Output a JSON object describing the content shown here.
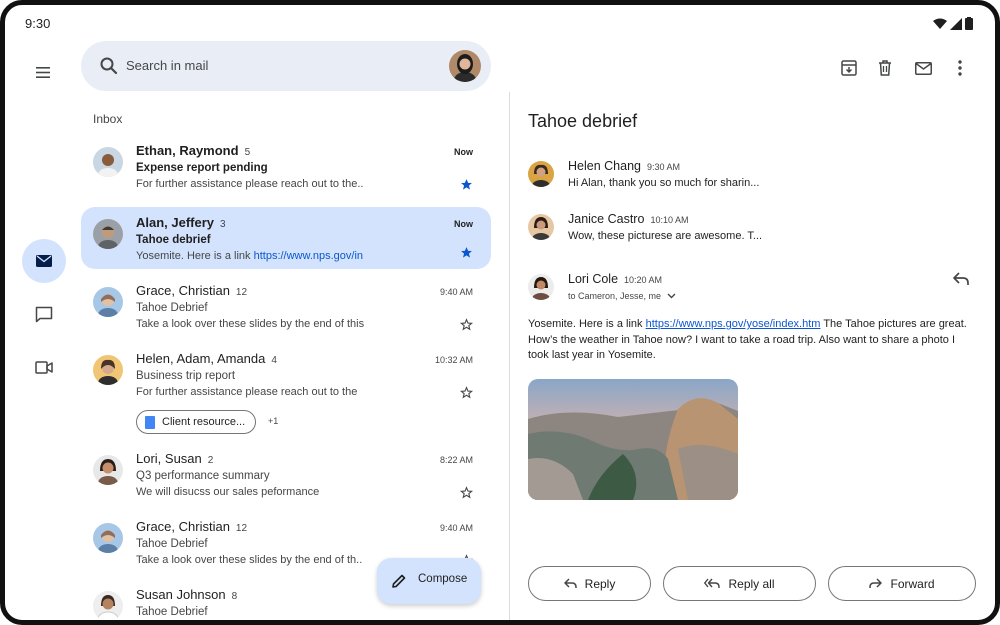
{
  "status_bar": {
    "time": "9:30"
  },
  "search": {
    "placeholder": "Search in mail"
  },
  "inbox_label": "Inbox",
  "emails": [
    {
      "sender": "Ethan, Raymond",
      "count": "5",
      "time": "Now",
      "subject": "Expense report pending",
      "snippet": "For further assistance please reach out to the..",
      "unread": true,
      "starred": true,
      "selected": false
    },
    {
      "sender": "Alan, Jeffery",
      "count": "3",
      "time": "Now",
      "subject": "Tahoe debrief",
      "snippet": "Yosemite. Here is a link ",
      "snippet_link": "https://www.nps.gov/in",
      "unread": true,
      "starred": true,
      "selected": true
    },
    {
      "sender": "Grace, Christian",
      "count": "12",
      "time": "9:40 AM",
      "subject": "Tahoe Debrief",
      "snippet": "Take a look over these slides by the end of this",
      "unread": false,
      "starred": false,
      "selected": false
    },
    {
      "sender": "Helen, Adam, Amanda",
      "count": "4",
      "time": "10:32 AM",
      "subject": "Business trip report",
      "snippet": "For further assistance please reach out to the",
      "unread": false,
      "starred": false,
      "selected": false,
      "attachment": "Client resource...",
      "attachment_more": "+1"
    },
    {
      "sender": "Lori, Susan",
      "count": "2",
      "time": "8:22 AM",
      "subject": "Q3 performance summary",
      "snippet": "We will disucss our sales peformance",
      "unread": false,
      "starred": false,
      "selected": false
    },
    {
      "sender": "Grace, Christian",
      "count": "12",
      "time": "9:40 AM",
      "subject": "Tahoe Debrief",
      "snippet": "Take a look over these slides by the end of th..",
      "unread": false,
      "starred": false,
      "selected": false
    },
    {
      "sender": "Susan Johnson",
      "count": "8",
      "time": "",
      "subject": "Tahoe Debrief",
      "snippet": "",
      "unread": false,
      "starred": false,
      "selected": false
    }
  ],
  "compose": {
    "label": "Compose"
  },
  "thread": {
    "title": "Tahoe debrief",
    "messages": [
      {
        "name": "Helen Chang",
        "time": "9:30 AM",
        "snippet": "Hi Alan, thank you so much for sharin..."
      },
      {
        "name": "Janice Castro",
        "time": "10:10 AM",
        "snippet": "Wow, these picturese are awesome. T..."
      },
      {
        "name": "Lori Cole",
        "time": "10:20 AM",
        "to": "to Cameron, Jesse, me"
      }
    ],
    "body": {
      "before_link": "Yosemite. Here is a link ",
      "link": "https://www.nps.gov/yose/index.htm",
      "after_link": " The Tahoe pictures are great. How’s the weather in Tahoe now? I want to take a road trip. Also want to share a photo I took last year in Yosemite."
    }
  },
  "actions": {
    "reply": "Reply",
    "reply_all": "Reply all",
    "forward": "Forward"
  },
  "icons": {
    "menu": "menu-icon",
    "mail": "mail-icon",
    "chat": "chat-icon",
    "meet": "video-icon",
    "archive": "archive-icon",
    "delete": "trash-icon",
    "mark_unread": "envelope-icon",
    "more": "more-vert-icon"
  },
  "colors": {
    "selected_bg": "#d3e3fd",
    "search_bg": "#e9eef6",
    "link": "#0b57d0",
    "star": "#0b57d0"
  }
}
